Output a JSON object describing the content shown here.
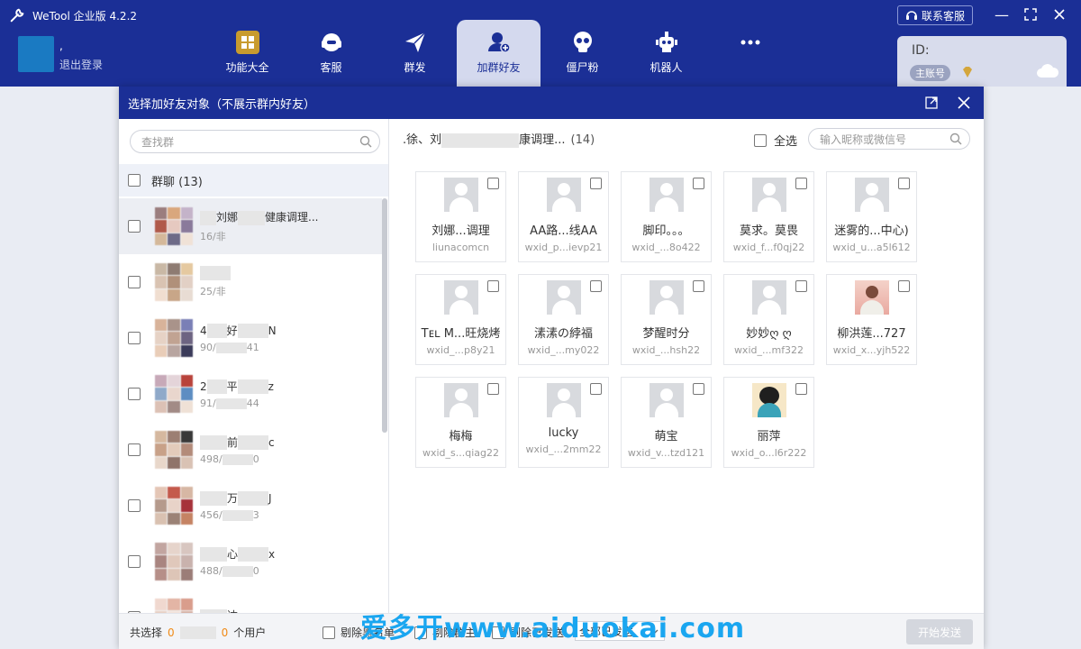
{
  "app": {
    "title": "WeTool 企业版 4.2.2"
  },
  "user": {
    "name": ",",
    "logout": "退出登录"
  },
  "nav": [
    {
      "label": "功能大全",
      "icon": "grid-icon"
    },
    {
      "label": "客服",
      "icon": "headset-icon"
    },
    {
      "label": "群发",
      "icon": "send-icon"
    },
    {
      "label": "加群好友",
      "icon": "add-user-icon",
      "active": true
    },
    {
      "label": "僵尸粉",
      "icon": "skull-icon"
    },
    {
      "label": "机器人",
      "icon": "robot-icon"
    },
    {
      "label": "",
      "icon": "more-icon"
    }
  ],
  "contact_button": "联系客服",
  "account": {
    "id_label": "ID:",
    "badge": "主账号"
  },
  "dialog": {
    "title": "选择加好友对象（不展示群内好友）",
    "left": {
      "search_placeholder": "查找群",
      "group_header": "群聊",
      "group_count": "(13)",
      "groups": [
        {
          "name": "刘娜",
          "name2": "健康调理...",
          "sub": "16/非"
        },
        {
          "name": "",
          "name2": "",
          "sub": "25/非"
        },
        {
          "name": "4",
          "name2": "好",
          "sub": "90/",
          "sub2": "41",
          "tail": "N"
        },
        {
          "name": "2",
          "name2": "平",
          "sub": "91/",
          "sub2": "44",
          "tail": "z"
        },
        {
          "name": "",
          "name2": "前",
          "sub": "498/",
          "sub2": "0",
          "tail": "c"
        },
        {
          "name": "",
          "name2": "万",
          "sub": "456/",
          "sub2": "3",
          "tail": "J"
        },
        {
          "name": "",
          "name2": "心",
          "sub": "488/",
          "sub2": "0",
          "tail": "x"
        },
        {
          "name": "",
          "name2": "达",
          "sub": "",
          "sub2": "",
          "tail": ""
        }
      ]
    },
    "right": {
      "group_title": ".徐、刘",
      "group_title2": "康调理...",
      "count": "(14)",
      "select_all": "全选",
      "search_placeholder": "输入昵称或微信号",
      "members": [
        {
          "name": "刘娜...调理",
          "wxid": "liunacomcn",
          "avatar": "default"
        },
        {
          "name": "AA路...线AA",
          "wxid": "wxid_p...ievp21",
          "avatar": "default"
        },
        {
          "name": "脚印。。。",
          "wxid": "wxid_...8o422",
          "avatar": "default"
        },
        {
          "name": "莫求。莫畏",
          "wxid": "wxid_f...f0qj22",
          "avatar": "default"
        },
        {
          "name": "迷雾的...中心)",
          "wxid": "wxid_u...a5l612",
          "avatar": "default"
        },
        {
          "name": "Tᴇʟ M...旺烧烤",
          "wxid": "wxid_...p8y21",
          "avatar": "default"
        },
        {
          "name": "溸溸の綍福",
          "wxid": "wxid_...my022",
          "avatar": "default"
        },
        {
          "name": "梦醒时分",
          "wxid": "wxid_...hsh22",
          "avatar": "default"
        },
        {
          "name": "妙妙ღ ღ",
          "wxid": "wxid_...mf322",
          "avatar": "default"
        },
        {
          "name": "柳洪莲...727",
          "wxid": "wxid_x...yjh522",
          "avatar": "photo1"
        },
        {
          "name": "梅梅",
          "wxid": "wxid_s...qiag22",
          "avatar": "default"
        },
        {
          "name": "lucky",
          "wxid": "wxid_...2mm22",
          "avatar": "default"
        },
        {
          "name": "萌宝",
          "wxid": "wxid_v...tzd121",
          "avatar": "default"
        },
        {
          "name": "丽萍",
          "wxid": "wxid_o...l6r222",
          "avatar": "photo2"
        }
      ]
    },
    "footer": {
      "selected_prefix": "共选择",
      "selected_groups": "0",
      "selected_users": "0",
      "users_suffix": "个用户",
      "exclude_blacklist": "剔除黑名单",
      "exclude_owner": "剔除群主",
      "exclude_sent": "剔除已发送",
      "send_filter": "全部已发送",
      "start_button": "开始发送"
    }
  },
  "watermark": "爱多开www.aiduokai.com",
  "colors": {
    "primary": "#1b2f96",
    "accent": "#f08a16",
    "watermark": "#1aa6f0"
  }
}
